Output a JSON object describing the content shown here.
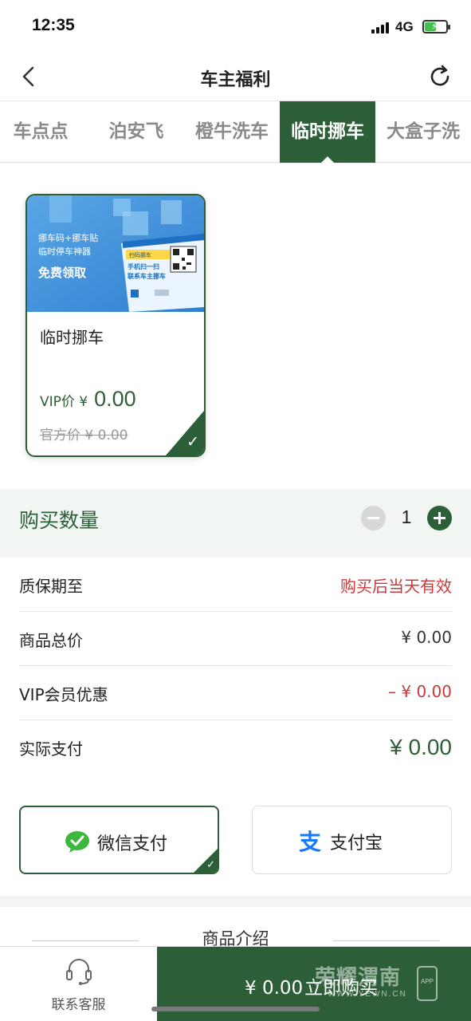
{
  "status_bar": {
    "time": "12:35",
    "network": "4G"
  },
  "nav": {
    "title": "车主福利"
  },
  "tabs": [
    {
      "label": "车点点",
      "active": false
    },
    {
      "label": "泊安飞",
      "active": false
    },
    {
      "label": "橙牛洗车",
      "active": false
    },
    {
      "label": "临时挪车",
      "active": true
    },
    {
      "label": "大盒子洗",
      "active": false
    }
  ],
  "product": {
    "name": "临时挪车",
    "vip_label": "VIP价 ¥",
    "vip_price": "0.00",
    "official_price": "官方价 ¥ 0.00",
    "image": {
      "line1": "挪车码+挪车贴",
      "line2": "临时停车神器",
      "line3": "免费领取",
      "qr_top": "扫码挪车",
      "qr_line1": "手机扫一扫",
      "qr_line2": "联系车主挪车"
    }
  },
  "quantity": {
    "label": "购买数量",
    "value": "1"
  },
  "details": {
    "warranty": {
      "label": "质保期至",
      "value": "购买后当天有效"
    },
    "total": {
      "label": "商品总价",
      "value": "¥ 0.00"
    },
    "vip_discount": {
      "label": "VIP会员优惠",
      "value": "– ¥ 0.00"
    },
    "actual": {
      "label": "实际支付",
      "value": "¥ 0.00"
    }
  },
  "payment": {
    "wechat": {
      "label": "微信支付",
      "selected": true
    },
    "alipay": {
      "label": "支付宝",
      "selected": false
    }
  },
  "intro": {
    "title": "商品介绍"
  },
  "bottom": {
    "service_label": "联系客服",
    "buy_price": "¥ 0.00",
    "buy_label": "立即购买",
    "watermark": "荣耀渭南",
    "watermark_url": "WWW.YEWN.CN",
    "watermark_app": "APP"
  },
  "colors": {
    "primary": "#2c5f37",
    "danger": "#c83a3a",
    "wechat": "#3db83f",
    "alipay": "#1677ff"
  }
}
